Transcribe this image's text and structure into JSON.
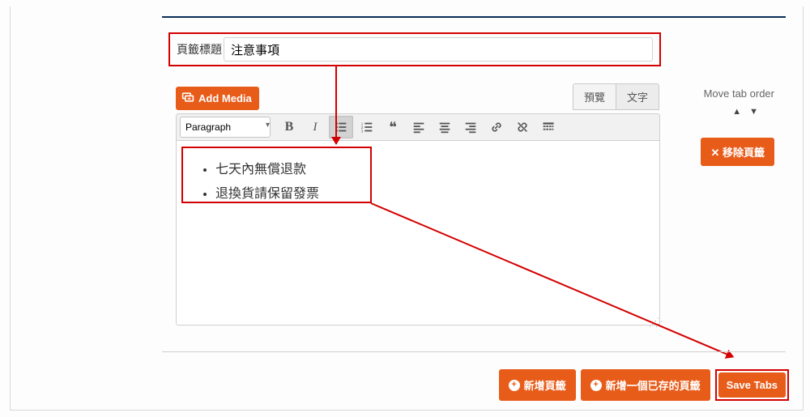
{
  "colors": {
    "accent": "#e85c1a",
    "annotation": "#d40000"
  },
  "tab_title": {
    "label": "頁籤標題",
    "value": "注意事項"
  },
  "add_media": "Add Media",
  "editor_tabs": {
    "visual": "預覽",
    "text": "文字"
  },
  "move_tab": {
    "label": "Move tab order",
    "up": "▲",
    "down": "▼"
  },
  "remove_tab": "移除頁籤",
  "toolbar": {
    "format": "Paragraph",
    "buttons": {
      "bold": "B",
      "italic": "I",
      "ul": "bulleted-list",
      "ol": "numbered-list",
      "quote": "quote",
      "align_left": "align-left",
      "align_center": "align-center",
      "align_right": "align-right",
      "link": "link",
      "unlink": "unlink",
      "kitchen": "toggle"
    }
  },
  "content": {
    "items": [
      "七天內無償退款",
      "退換貨請保留發票"
    ]
  },
  "bottom": {
    "add_tab": "新增頁籤",
    "add_existing": "新增一個已存的頁籤",
    "save": "Save Tabs"
  }
}
